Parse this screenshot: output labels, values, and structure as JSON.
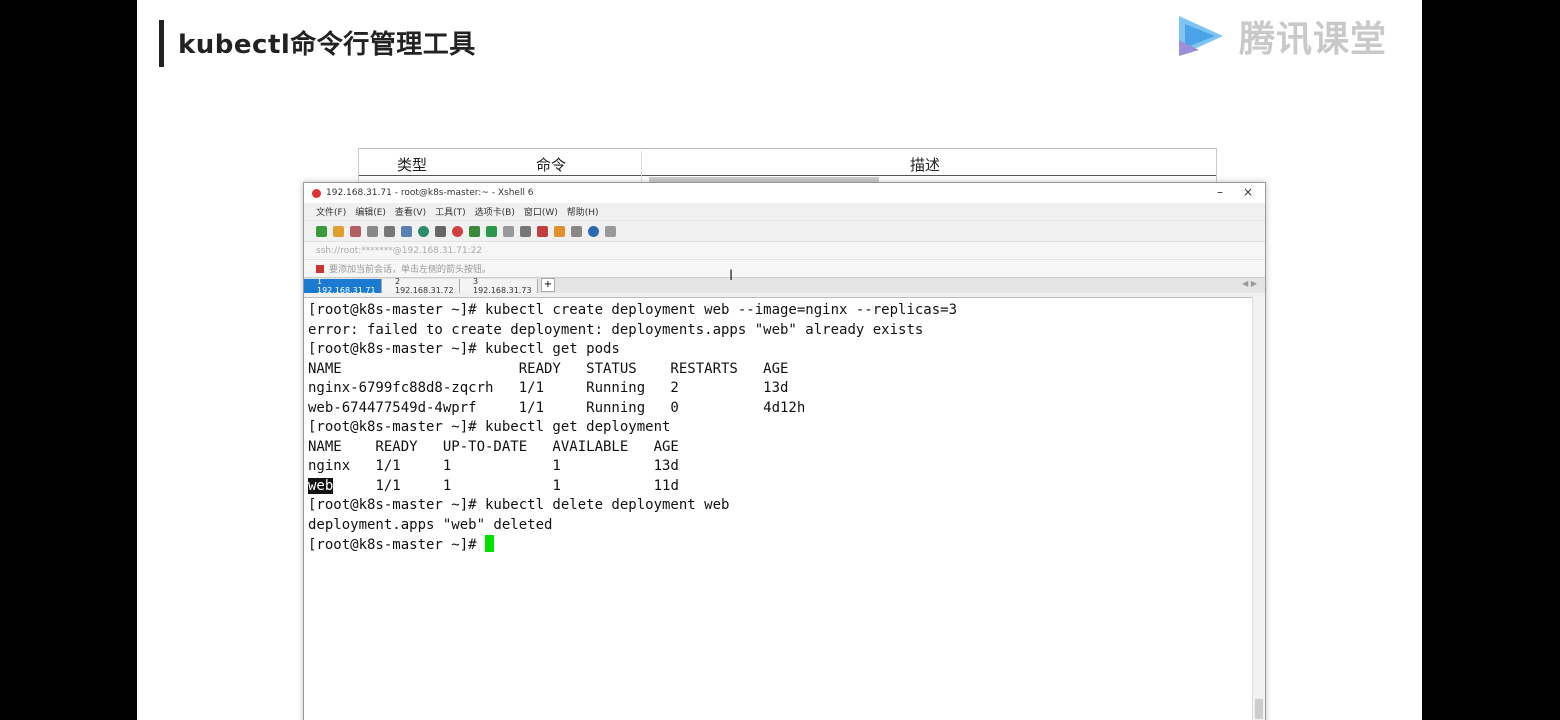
{
  "slide": {
    "title": "kubectl命令行管理工具",
    "logo_text": "腾讯课堂"
  },
  "bg_table": {
    "headers": [
      "类型",
      "命令",
      "描述"
    ]
  },
  "xshell": {
    "window_title": "192.168.31.71 - root@k8s-master:~ - Xshell 6",
    "controls": {
      "minimize": "–",
      "close": "×"
    },
    "menu": [
      "文件(F)",
      "编辑(E)",
      "查看(V)",
      "工具(T)",
      "选项卡(B)",
      "窗口(W)",
      "帮助(H)"
    ],
    "address": "ssh://root:*******@192.168.31.71:22",
    "hint": "要添加当前会话，单击左侧的箭头按钮。",
    "tabs": [
      {
        "label": "1 192.168.31.71",
        "active": true
      },
      {
        "label": "2 192.168.31.72",
        "active": false
      },
      {
        "label": "3 192.168.31.73",
        "active": false
      }
    ],
    "tab_add": "+",
    "tab_nav": "◀ ▶"
  },
  "terminal": {
    "lines": [
      "[root@k8s-master ~]# kubectl create deployment web --image=nginx --replicas=3",
      "error: failed to create deployment: deployments.apps \"web\" already exists",
      "[root@k8s-master ~]# kubectl get pods",
      "NAME                     READY   STATUS    RESTARTS   AGE",
      "nginx-6799fc88d8-zqcrh   1/1     Running   2          13d",
      "web-674477549d-4wprf     1/1     Running   0          4d12h",
      "[root@k8s-master ~]# kubectl get deployment",
      "NAME    READY   UP-TO-DATE   AVAILABLE   AGE",
      "nginx   1/1     1            1           13d"
    ],
    "selected_word": "web",
    "selected_rest": "     1/1     1            1           11d",
    "after_lines": [
      "[root@k8s-master ~]# kubectl delete deployment web",
      "deployment.apps \"web\" deleted"
    ],
    "prompt": "[root@k8s-master ~]# ",
    "cursor_color": "#00e000"
  },
  "colors": {
    "tab_active": "#1a7bd1",
    "logo_play": "#4aa3e8"
  }
}
